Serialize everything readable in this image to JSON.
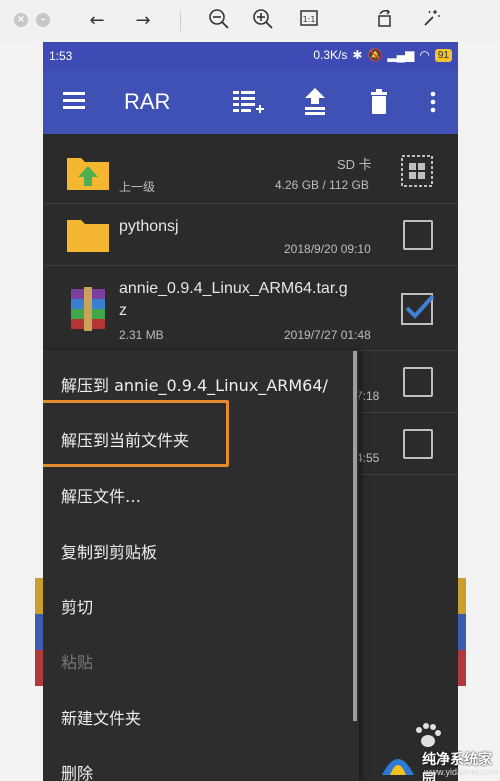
{
  "viewer": {
    "buttons": [
      "back-arrow-icon",
      "forward-arrow-icon",
      "zoom-out-icon",
      "zoom-in-icon",
      "actual-size-icon",
      "rotate-icon",
      "magic-wand-icon"
    ]
  },
  "status_bar": {
    "time": "1:53",
    "speed": "0.3K/s",
    "battery": "91"
  },
  "app_bar": {
    "title": "RAR"
  },
  "files": [
    {
      "name": "",
      "sub_left": "上一级",
      "sub_right_top": "SD 卡",
      "sub_right": "4.26 GB / 112 GB"
    },
    {
      "name": "pythonsj",
      "date": "2018/9/20 09:10"
    },
    {
      "name": "annie_0.9.4_Linux_ARM64.tar.g",
      "name2": "z",
      "size": "2.31 MB",
      "date": "2019/7/27 01:48"
    },
    {
      "date_partial": "7:18"
    },
    {
      "date_partial": "4:55"
    }
  ],
  "context_menu": {
    "items": [
      {
        "label": "解压到 annie_0.9.4_Linux_ARM64/",
        "enabled": true
      },
      {
        "label": "解压到当前文件夹",
        "enabled": true
      },
      {
        "label": "解压文件…",
        "enabled": true
      },
      {
        "label": "复制到剪贴板",
        "enabled": true
      },
      {
        "label": "剪切",
        "enabled": true
      },
      {
        "label": "粘贴",
        "enabled": false
      },
      {
        "label": "新建文件夹",
        "enabled": true
      },
      {
        "label": "删除",
        "enabled": true
      }
    ]
  },
  "watermark": {
    "title": "纯净系统家园",
    "url": "www.yidaimei.com"
  },
  "colors": {
    "app_bar": "#3f51b5",
    "highlight": "#e58a2e",
    "folder": "#f5b731",
    "checkmark": "#3f7fd6"
  }
}
